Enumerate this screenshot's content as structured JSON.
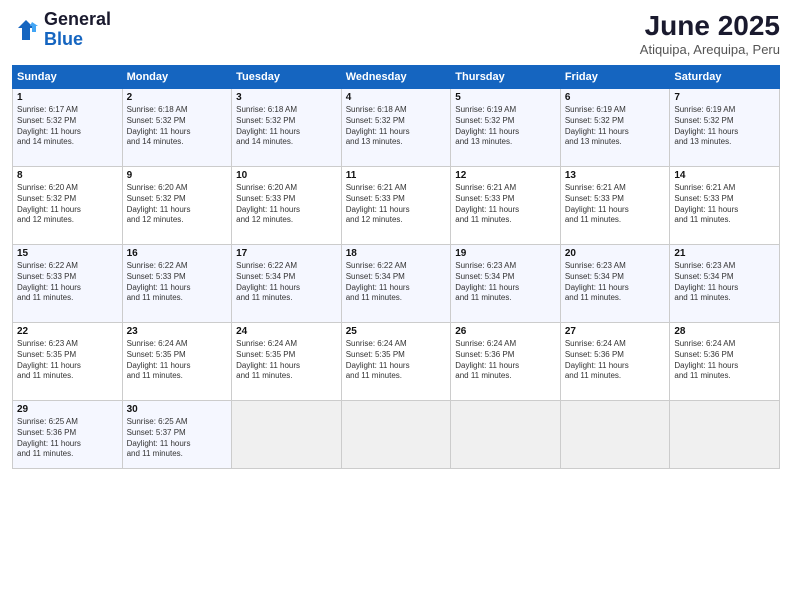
{
  "header": {
    "logo_line1": "General",
    "logo_line2": "Blue",
    "month": "June 2025",
    "location": "Atiquipa, Arequipa, Peru"
  },
  "days_of_week": [
    "Sunday",
    "Monday",
    "Tuesday",
    "Wednesday",
    "Thursday",
    "Friday",
    "Saturday"
  ],
  "weeks": [
    [
      {
        "day": "1",
        "info": "Sunrise: 6:17 AM\nSunset: 5:32 PM\nDaylight: 11 hours\nand 14 minutes."
      },
      {
        "day": "2",
        "info": "Sunrise: 6:18 AM\nSunset: 5:32 PM\nDaylight: 11 hours\nand 14 minutes."
      },
      {
        "day": "3",
        "info": "Sunrise: 6:18 AM\nSunset: 5:32 PM\nDaylight: 11 hours\nand 14 minutes."
      },
      {
        "day": "4",
        "info": "Sunrise: 6:18 AM\nSunset: 5:32 PM\nDaylight: 11 hours\nand 13 minutes."
      },
      {
        "day": "5",
        "info": "Sunrise: 6:19 AM\nSunset: 5:32 PM\nDaylight: 11 hours\nand 13 minutes."
      },
      {
        "day": "6",
        "info": "Sunrise: 6:19 AM\nSunset: 5:32 PM\nDaylight: 11 hours\nand 13 minutes."
      },
      {
        "day": "7",
        "info": "Sunrise: 6:19 AM\nSunset: 5:32 PM\nDaylight: 11 hours\nand 13 minutes."
      }
    ],
    [
      {
        "day": "8",
        "info": "Sunrise: 6:20 AM\nSunset: 5:32 PM\nDaylight: 11 hours\nand 12 minutes."
      },
      {
        "day": "9",
        "info": "Sunrise: 6:20 AM\nSunset: 5:32 PM\nDaylight: 11 hours\nand 12 minutes."
      },
      {
        "day": "10",
        "info": "Sunrise: 6:20 AM\nSunset: 5:33 PM\nDaylight: 11 hours\nand 12 minutes."
      },
      {
        "day": "11",
        "info": "Sunrise: 6:21 AM\nSunset: 5:33 PM\nDaylight: 11 hours\nand 12 minutes."
      },
      {
        "day": "12",
        "info": "Sunrise: 6:21 AM\nSunset: 5:33 PM\nDaylight: 11 hours\nand 11 minutes."
      },
      {
        "day": "13",
        "info": "Sunrise: 6:21 AM\nSunset: 5:33 PM\nDaylight: 11 hours\nand 11 minutes."
      },
      {
        "day": "14",
        "info": "Sunrise: 6:21 AM\nSunset: 5:33 PM\nDaylight: 11 hours\nand 11 minutes."
      }
    ],
    [
      {
        "day": "15",
        "info": "Sunrise: 6:22 AM\nSunset: 5:33 PM\nDaylight: 11 hours\nand 11 minutes."
      },
      {
        "day": "16",
        "info": "Sunrise: 6:22 AM\nSunset: 5:33 PM\nDaylight: 11 hours\nand 11 minutes."
      },
      {
        "day": "17",
        "info": "Sunrise: 6:22 AM\nSunset: 5:34 PM\nDaylight: 11 hours\nand 11 minutes."
      },
      {
        "day": "18",
        "info": "Sunrise: 6:22 AM\nSunset: 5:34 PM\nDaylight: 11 hours\nand 11 minutes."
      },
      {
        "day": "19",
        "info": "Sunrise: 6:23 AM\nSunset: 5:34 PM\nDaylight: 11 hours\nand 11 minutes."
      },
      {
        "day": "20",
        "info": "Sunrise: 6:23 AM\nSunset: 5:34 PM\nDaylight: 11 hours\nand 11 minutes."
      },
      {
        "day": "21",
        "info": "Sunrise: 6:23 AM\nSunset: 5:34 PM\nDaylight: 11 hours\nand 11 minutes."
      }
    ],
    [
      {
        "day": "22",
        "info": "Sunrise: 6:23 AM\nSunset: 5:35 PM\nDaylight: 11 hours\nand 11 minutes."
      },
      {
        "day": "23",
        "info": "Sunrise: 6:24 AM\nSunset: 5:35 PM\nDaylight: 11 hours\nand 11 minutes."
      },
      {
        "day": "24",
        "info": "Sunrise: 6:24 AM\nSunset: 5:35 PM\nDaylight: 11 hours\nand 11 minutes."
      },
      {
        "day": "25",
        "info": "Sunrise: 6:24 AM\nSunset: 5:35 PM\nDaylight: 11 hours\nand 11 minutes."
      },
      {
        "day": "26",
        "info": "Sunrise: 6:24 AM\nSunset: 5:36 PM\nDaylight: 11 hours\nand 11 minutes."
      },
      {
        "day": "27",
        "info": "Sunrise: 6:24 AM\nSunset: 5:36 PM\nDaylight: 11 hours\nand 11 minutes."
      },
      {
        "day": "28",
        "info": "Sunrise: 6:24 AM\nSunset: 5:36 PM\nDaylight: 11 hours\nand 11 minutes."
      }
    ],
    [
      {
        "day": "29",
        "info": "Sunrise: 6:25 AM\nSunset: 5:36 PM\nDaylight: 11 hours\nand 11 minutes."
      },
      {
        "day": "30",
        "info": "Sunrise: 6:25 AM\nSunset: 5:37 PM\nDaylight: 11 hours\nand 11 minutes."
      },
      {
        "day": "",
        "info": ""
      },
      {
        "day": "",
        "info": ""
      },
      {
        "day": "",
        "info": ""
      },
      {
        "day": "",
        "info": ""
      },
      {
        "day": "",
        "info": ""
      }
    ]
  ]
}
